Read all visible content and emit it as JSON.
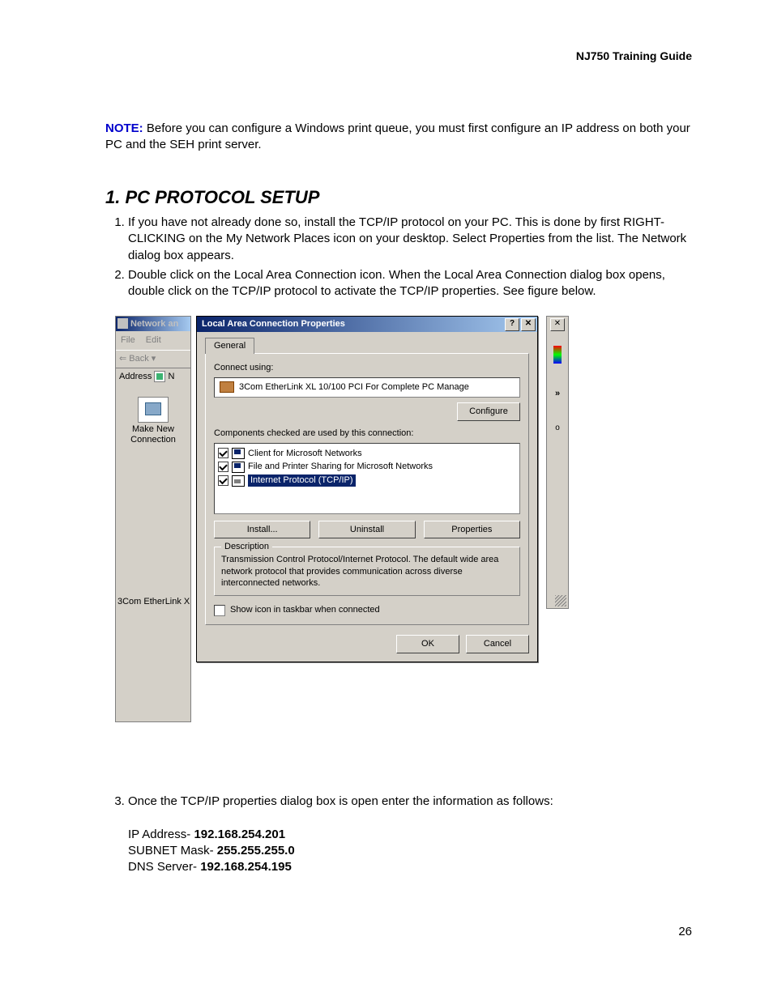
{
  "header": {
    "title": "NJ750 Training Guide"
  },
  "note": {
    "label": "NOTE:",
    "text": "Before you can configure a Windows print queue, you must first configure an IP address on both your PC and the SEH print server."
  },
  "section": {
    "heading": "1. PC PROTOCOL SETUP"
  },
  "steps": {
    "s1": "If you have not already done so, install the TCP/IP protocol on your PC. This is done by first RIGHT-CLICKING on the My Network Places icon on your desktop. Select Properties from the list. The Network dialog box appears.",
    "s2": "Double click on the Local Area Connection icon. When the Local Area Connection dialog box opens, double click on the TCP/IP protocol to activate the TCP/IP properties. See figure below.",
    "s3": "Once the TCP/IP properties dialog box is open enter the information as follows:"
  },
  "vals": {
    "ip_lbl": "IP Address- ",
    "ip": "192.168.254.201",
    "mask_lbl": "SUBNET Mask- ",
    "mask": "255.255.255.0",
    "dns_lbl": "DNS Server- ",
    "dns": "192.168.254.195"
  },
  "bgwin": {
    "title": "Network an",
    "menu_file": "File",
    "menu_edit": "Edit",
    "back": "⇐ Back ▾",
    "address_lbl": "Address",
    "icon_caption_1": "Make New",
    "icon_caption_2": "Connection",
    "bottom_text": "3Com EtherLink X"
  },
  "rightstrip": {
    "close": "✕",
    "chev": "»",
    "o": "o"
  },
  "dlg": {
    "title": "Local Area Connection Properties",
    "help": "?",
    "close": "✕",
    "tab_general": "General",
    "connect_using": "Connect using:",
    "nic": "3Com EtherLink XL 10/100 PCI For Complete PC Manage",
    "configure": "Configure",
    "components_lbl": "Components checked are used by this connection:",
    "comp1": "Client for Microsoft Networks",
    "comp2": "File and Printer Sharing for Microsoft Networks",
    "comp3": "Internet Protocol (TCP/IP)",
    "install": "Install...",
    "uninstall": "Uninstall",
    "properties": "Properties",
    "desc_title": "Description",
    "desc_text": "Transmission Control Protocol/Internet Protocol. The default wide area network protocol that provides communication across diverse interconnected networks.",
    "show_icon": "Show icon in taskbar when connected",
    "ok": "OK",
    "cancel": "Cancel"
  },
  "page_number": "26"
}
